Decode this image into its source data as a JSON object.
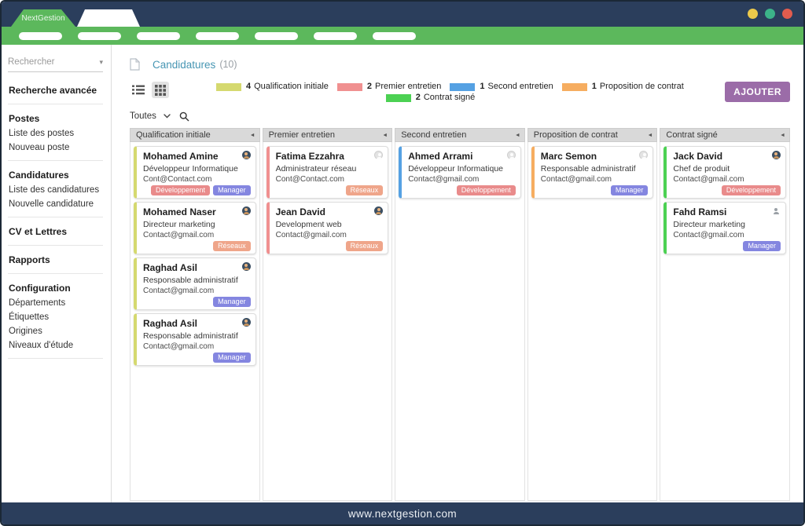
{
  "window": {
    "brand": "NextGestion",
    "controls": [
      {
        "name": "minimize",
        "color": "#ecc94b"
      },
      {
        "name": "maximize",
        "color": "#3cb389"
      },
      {
        "name": "close",
        "color": "#e25c4e"
      }
    ]
  },
  "navbar": {
    "pill_count": 7
  },
  "icons": {
    "select_caret": "▾",
    "column_collapse": "◄"
  },
  "sidebar": {
    "search_placeholder": "Rechercher",
    "groups": [
      {
        "items": [
          {
            "label": "Recherche avancée",
            "bold": true
          }
        ]
      },
      {
        "items": [
          {
            "label": "Postes",
            "bold": true
          },
          {
            "label": "Liste des postes",
            "bold": false
          },
          {
            "label": "Nouveau poste",
            "bold": false
          }
        ]
      },
      {
        "items": [
          {
            "label": "Candidatures",
            "bold": true
          },
          {
            "label": "Liste des candidatures",
            "bold": false
          },
          {
            "label": "Nouvelle candidature",
            "bold": false
          }
        ]
      },
      {
        "items": [
          {
            "label": "CV et Lettres",
            "bold": true
          }
        ]
      },
      {
        "items": [
          {
            "label": "Rapports",
            "bold": true
          }
        ]
      },
      {
        "items": [
          {
            "label": "Configuration",
            "bold": true
          },
          {
            "label": "Départements",
            "bold": false
          },
          {
            "label": "Étiquettes",
            "bold": false
          },
          {
            "label": "Origines",
            "bold": false
          },
          {
            "label": "Niveaux d'étude",
            "bold": false
          }
        ]
      }
    ]
  },
  "header": {
    "title": "Candidatures",
    "count": "(10)"
  },
  "legend": {
    "rows": [
      [
        {
          "count": "4",
          "label": "Qualification initiale",
          "color": "#d5d96f"
        },
        {
          "count": "2",
          "label": "Premier entretien",
          "color": "#f09090"
        },
        {
          "count": "1",
          "label": "Second entretien",
          "color": "#55a1e3"
        },
        {
          "count": "1",
          "label": "Proposition de contrat",
          "color": "#f6ad60"
        }
      ],
      [
        {
          "count": "2",
          "label": "Contrat signé",
          "color": "#4cd153"
        }
      ]
    ]
  },
  "toolbar": {
    "add_label": "AJOUTER",
    "filter_label": "Toutes"
  },
  "board": {
    "columns": [
      {
        "title": "Qualification initiale",
        "color": "#d5d96f",
        "cards": [
          {
            "name": "Mohamed Amine",
            "role": "Développeur Informatique",
            "email": "Cont@Contact.com",
            "avatar": "dark",
            "tags": [
              {
                "label": "Développement",
                "color": "#e98b8b"
              },
              {
                "label": "Manager",
                "color": "#8486e0"
              }
            ]
          },
          {
            "name": "Mohamed Naser",
            "role": "Directeur marketing",
            "email": "Contact@gmail.com",
            "avatar": "dark",
            "tags": [
              {
                "label": "Réseaux",
                "color": "#efa58a"
              }
            ]
          },
          {
            "name": "Raghad Asil",
            "role": "Responsable administratif",
            "email": "Contact@gmail.com",
            "avatar": "dark",
            "tags": [
              {
                "label": "Manager",
                "color": "#8486e0"
              }
            ]
          },
          {
            "name": "Raghad Asil",
            "role": "Responsable administratif",
            "email": "Contact@gmail.com",
            "avatar": "dark",
            "tags": [
              {
                "label": "Manager",
                "color": "#8486e0"
              }
            ]
          }
        ]
      },
      {
        "title": "Premier entretien",
        "color": "#f09090",
        "cards": [
          {
            "name": "Fatima Ezzahra",
            "role": "Administrateur réseau",
            "email": "Cont@Contact.com",
            "avatar": "light",
            "tags": [
              {
                "label": "Réseaux",
                "color": "#efa58a"
              }
            ]
          },
          {
            "name": "Jean David",
            "role": "Development web",
            "email": "Contact@gmail.com",
            "avatar": "dark",
            "tags": [
              {
                "label": "Réseaux",
                "color": "#efa58a"
              }
            ]
          }
        ]
      },
      {
        "title": "Second entretien",
        "color": "#55a1e3",
        "cards": [
          {
            "name": "Ahmed Arrami",
            "role": "Développeur Informatique",
            "email": "Contact@gmail.com",
            "avatar": "light",
            "tags": [
              {
                "label": "Développement",
                "color": "#e98b8b"
              }
            ]
          }
        ]
      },
      {
        "title": "Proposition de contrat",
        "color": "#f6ad60",
        "cards": [
          {
            "name": "Marc Semon",
            "role": "Responsable administratif",
            "email": "Contact@gmail.com",
            "avatar": "light",
            "tags": [
              {
                "label": "Manager",
                "color": "#8486e0"
              }
            ]
          }
        ]
      },
      {
        "title": "Contrat signé",
        "color": "#4cd153",
        "cards": [
          {
            "name": "Jack David",
            "role": "Chef de produit",
            "email": "Contact@gmail.com",
            "avatar": "dark",
            "tags": [
              {
                "label": "Développement",
                "color": "#e98b8b"
              }
            ]
          },
          {
            "name": "Fahd Ramsi",
            "role": "Directeur marketing",
            "email": "Contact@gmail.com",
            "avatar": "person",
            "tags": [
              {
                "label": "Manager",
                "color": "#8486e0"
              }
            ]
          }
        ]
      }
    ]
  },
  "footer": {
    "url": "www.nextgestion.com"
  }
}
